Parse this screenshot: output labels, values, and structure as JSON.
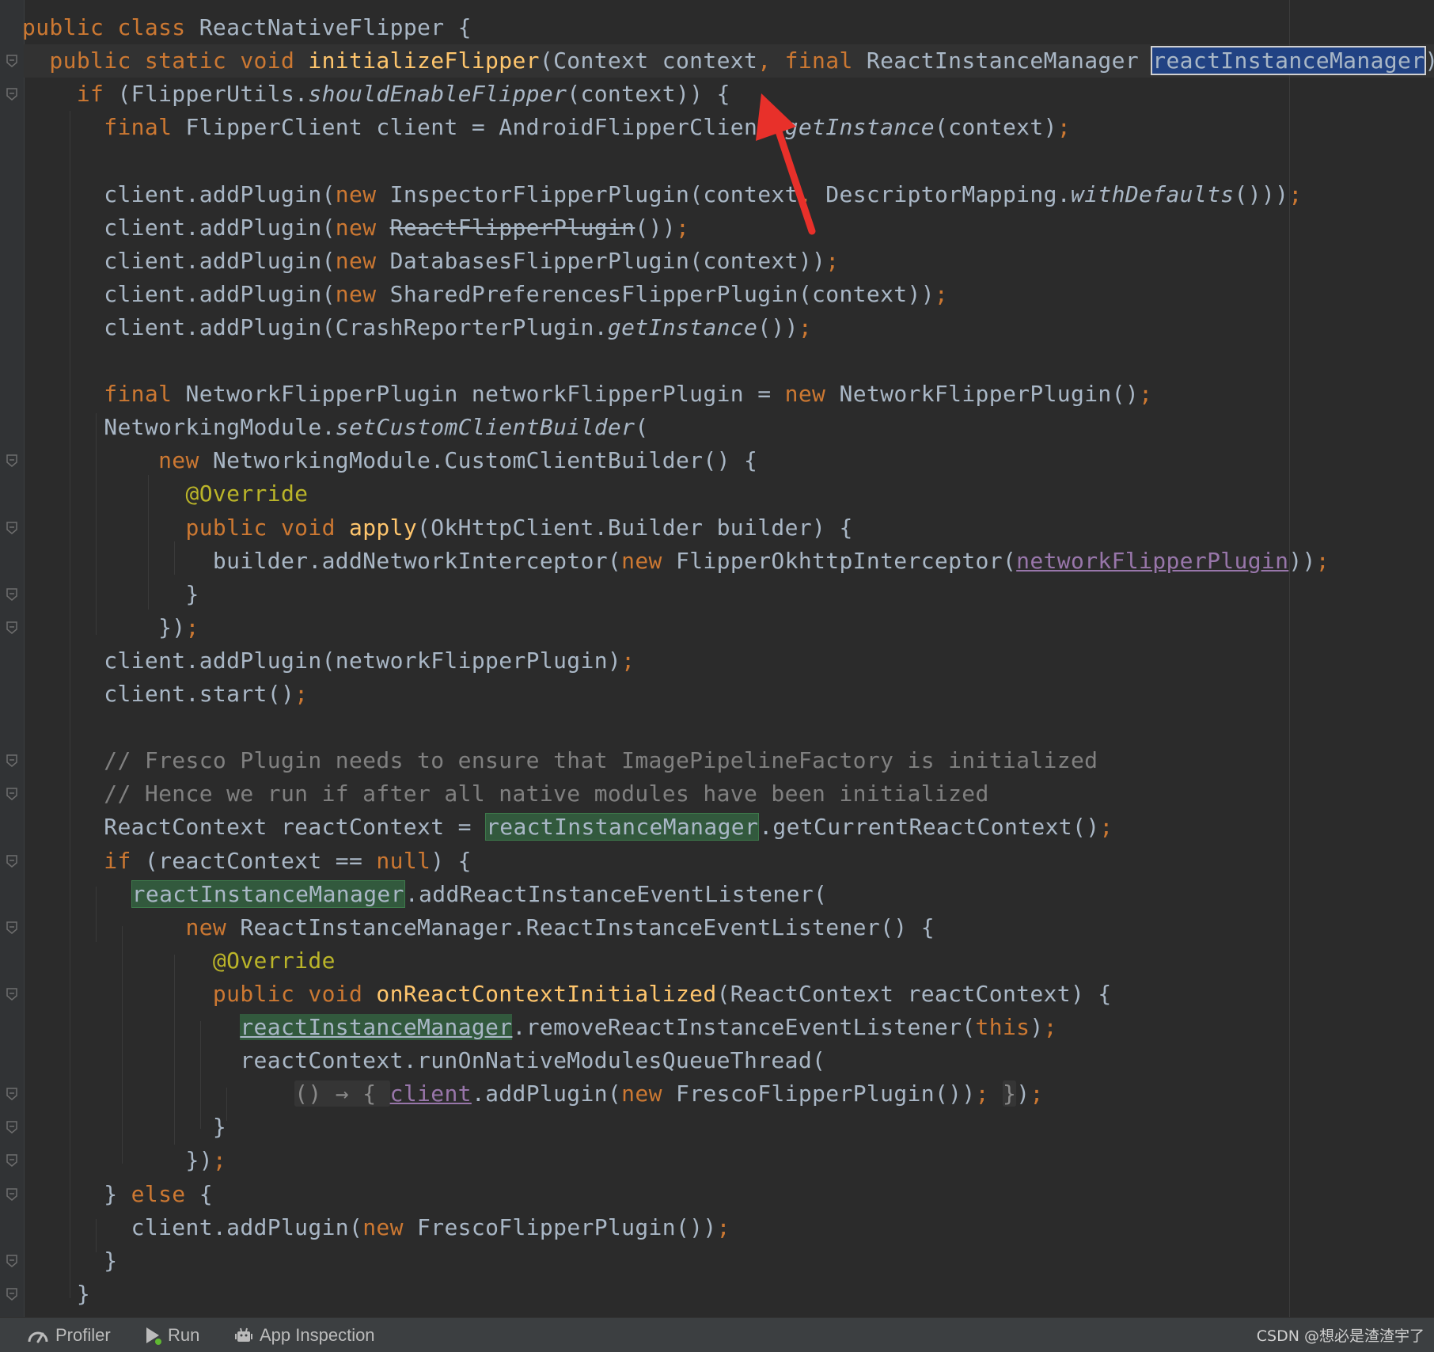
{
  "editor": {
    "lines": [
      [
        {
          "t": "public class ",
          "c": "kw"
        },
        {
          "t": "ReactNativeFlipper {",
          "c": ""
        }
      ],
      [
        {
          "t": "  public static void ",
          "c": "kw"
        },
        {
          "t": "initializeFlipper",
          "c": "fn"
        },
        {
          "t": "(Context context",
          "c": ""
        },
        {
          "t": ", final ",
          "c": "kw"
        },
        {
          "t": "ReactInstanceManager ",
          "c": ""
        },
        {
          "t": "reactInstanceManager",
          "c": "selected"
        },
        {
          "t": ") {",
          "c": ""
        }
      ],
      [
        {
          "t": "    if ",
          "c": "kw"
        },
        {
          "t": "(FlipperUtils.",
          "c": ""
        },
        {
          "t": "shouldEnableFlipper",
          "c": "it"
        },
        {
          "t": "(context)) {",
          "c": ""
        }
      ],
      [
        {
          "t": "      final ",
          "c": "kw"
        },
        {
          "t": "FlipperClient client = AndroidFlipperClient.",
          "c": ""
        },
        {
          "t": "getInstance",
          "c": "it"
        },
        {
          "t": "(context)",
          "c": ""
        },
        {
          "t": ";",
          "c": "kw"
        }
      ],
      [],
      [
        {
          "t": "      client.addPlugin(",
          "c": ""
        },
        {
          "t": "new ",
          "c": "kw"
        },
        {
          "t": "InspectorFlipperPlugin(context",
          "c": ""
        },
        {
          "t": ", ",
          "c": "kw"
        },
        {
          "t": "DescriptorMapping.",
          "c": ""
        },
        {
          "t": "withDefaults",
          "c": "it"
        },
        {
          "t": "()))",
          "c": ""
        },
        {
          "t": ";",
          "c": "kw"
        }
      ],
      [
        {
          "t": "      client.addPlugin(",
          "c": ""
        },
        {
          "t": "new ",
          "c": "kw"
        },
        {
          "t": "ReactFlipperPlugin",
          "c": "strike"
        },
        {
          "t": "())",
          "c": ""
        },
        {
          "t": ";",
          "c": "kw"
        }
      ],
      [
        {
          "t": "      client.addPlugin(",
          "c": ""
        },
        {
          "t": "new ",
          "c": "kw"
        },
        {
          "t": "DatabasesFlipperPlugin(context))",
          "c": ""
        },
        {
          "t": ";",
          "c": "kw"
        }
      ],
      [
        {
          "t": "      client.addPlugin(",
          "c": ""
        },
        {
          "t": "new ",
          "c": "kw"
        },
        {
          "t": "SharedPreferencesFlipperPlugin(context))",
          "c": ""
        },
        {
          "t": ";",
          "c": "kw"
        }
      ],
      [
        {
          "t": "      client.addPlugin(CrashReporterPlugin.",
          "c": ""
        },
        {
          "t": "getInstance",
          "c": "it"
        },
        {
          "t": "())",
          "c": ""
        },
        {
          "t": ";",
          "c": "kw"
        }
      ],
      [],
      [
        {
          "t": "      final ",
          "c": "kw"
        },
        {
          "t": "NetworkFlipperPlugin networkFlipperPlugin = ",
          "c": ""
        },
        {
          "t": "new ",
          "c": "kw"
        },
        {
          "t": "NetworkFlipperPlugin()",
          "c": ""
        },
        {
          "t": ";",
          "c": "kw"
        }
      ],
      [
        {
          "t": "      NetworkingModule.",
          "c": ""
        },
        {
          "t": "setCustomClientBuilder",
          "c": "it"
        },
        {
          "t": "(",
          "c": ""
        }
      ],
      [
        {
          "t": "          new ",
          "c": "kw"
        },
        {
          "t": "NetworkingModule.CustomClientBuilder() {",
          "c": ""
        }
      ],
      [
        {
          "t": "            @Override",
          "c": "ann"
        }
      ],
      [
        {
          "t": "            public void ",
          "c": "kw"
        },
        {
          "t": "apply",
          "c": "fn"
        },
        {
          "t": "(OkHttpClient.Builder builder) {",
          "c": ""
        }
      ],
      [
        {
          "t": "              builder.addNetworkInterceptor(",
          "c": ""
        },
        {
          "t": "new ",
          "c": "kw"
        },
        {
          "t": "FlipperOkhttpInterceptor(",
          "c": ""
        },
        {
          "t": "networkFlipperPlugin",
          "c": "fld"
        },
        {
          "t": "))",
          "c": ""
        },
        {
          "t": ";",
          "c": "kw"
        }
      ],
      [
        {
          "t": "            }",
          "c": ""
        }
      ],
      [
        {
          "t": "          })",
          "c": ""
        },
        {
          "t": ";",
          "c": "kw"
        }
      ],
      [
        {
          "t": "      client.addPlugin(networkFlipperPlugin)",
          "c": ""
        },
        {
          "t": ";",
          "c": "kw"
        }
      ],
      [
        {
          "t": "      client.start()",
          "c": ""
        },
        {
          "t": ";",
          "c": "kw"
        }
      ],
      [],
      [
        {
          "t": "      // Fresco Plugin needs to ensure that ImagePipelineFactory is initialized",
          "c": "cm"
        }
      ],
      [
        {
          "t": "      // Hence we run if after all native modules have been initialized",
          "c": "cm"
        }
      ],
      [
        {
          "t": "      ReactContext reactContext = ",
          "c": ""
        },
        {
          "t": "reactInstanceManager",
          "c": "hl-green"
        },
        {
          "t": ".getCurrentReactContext()",
          "c": ""
        },
        {
          "t": ";",
          "c": "kw"
        }
      ],
      [
        {
          "t": "      if ",
          "c": "kw"
        },
        {
          "t": "(reactContext == ",
          "c": ""
        },
        {
          "t": "null",
          "c": "kw"
        },
        {
          "t": ") {",
          "c": ""
        }
      ],
      [
        {
          "t": "        ",
          "c": ""
        },
        {
          "t": "reactInstanceManager",
          "c": "hl-green"
        },
        {
          "t": ".addReactInstanceEventListener(",
          "c": ""
        }
      ],
      [
        {
          "t": "            new ",
          "c": "kw"
        },
        {
          "t": "ReactInstanceManager.ReactInstanceEventListener() {",
          "c": ""
        }
      ],
      [
        {
          "t": "              @Override",
          "c": "ann"
        }
      ],
      [
        {
          "t": "              public void ",
          "c": "kw"
        },
        {
          "t": "onReactContextInitialized",
          "c": "fn"
        },
        {
          "t": "(ReactContext reactContext) {",
          "c": ""
        }
      ],
      [
        {
          "t": "                ",
          "c": ""
        },
        {
          "t": "reactInstanceManager",
          "c": "hl-green-u"
        },
        {
          "t": ".removeReactInstanceEventListener(",
          "c": ""
        },
        {
          "t": "this",
          "c": "kw"
        },
        {
          "t": ")",
          "c": ""
        },
        {
          "t": ";",
          "c": "kw"
        }
      ],
      [
        {
          "t": "                reactContext.runOnNativeModulesQueueThread(",
          "c": ""
        }
      ],
      [
        {
          "t": "                    ",
          "c": ""
        },
        {
          "t": "() → { ",
          "c": "lambda-hint"
        },
        {
          "t": "client",
          "c": "fld"
        },
        {
          "t": ".addPlugin(",
          "c": ""
        },
        {
          "t": "new ",
          "c": "kw"
        },
        {
          "t": "FrescoFlipperPlugin())",
          "c": ""
        },
        {
          "t": "; ",
          "c": "kw"
        },
        {
          "t": "}",
          "c": "lambda-hint"
        },
        {
          "t": ")",
          "c": ""
        },
        {
          "t": ";",
          "c": "kw"
        }
      ],
      [
        {
          "t": "              }",
          "c": ""
        }
      ],
      [
        {
          "t": "            })",
          "c": ""
        },
        {
          "t": ";",
          "c": "kw"
        }
      ],
      [
        {
          "t": "      } ",
          "c": ""
        },
        {
          "t": "else ",
          "c": "kw"
        },
        {
          "t": "{",
          "c": ""
        }
      ],
      [
        {
          "t": "        client.addPlugin(",
          "c": ""
        },
        {
          "t": "new ",
          "c": "kw"
        },
        {
          "t": "FrescoFlipperPlugin())",
          "c": ""
        },
        {
          "t": ";",
          "c": "kw"
        }
      ],
      [
        {
          "t": "      }",
          "c": ""
        }
      ],
      [
        {
          "t": "    }",
          "c": ""
        }
      ]
    ]
  },
  "statusbar": {
    "profiler_label": "Profiler",
    "run_label": "Run",
    "app_inspection_label": "App Inspection",
    "watermark": "CSDN @想必是渣渣宇了"
  },
  "colors": {
    "background": "#2b2b2b",
    "keyword": "#cc7832",
    "method": "#ffc66d",
    "comment": "#808080",
    "annotation": "#bbb529",
    "field": "#9876aa",
    "selection": "#214283",
    "usage_highlight": "#32593d",
    "annotation_arrow": "#e8302a"
  },
  "icons": {
    "profiler": "gauge-icon",
    "run": "play-icon",
    "app_inspection": "robot-icon",
    "fold": "fold-marker-icon"
  }
}
